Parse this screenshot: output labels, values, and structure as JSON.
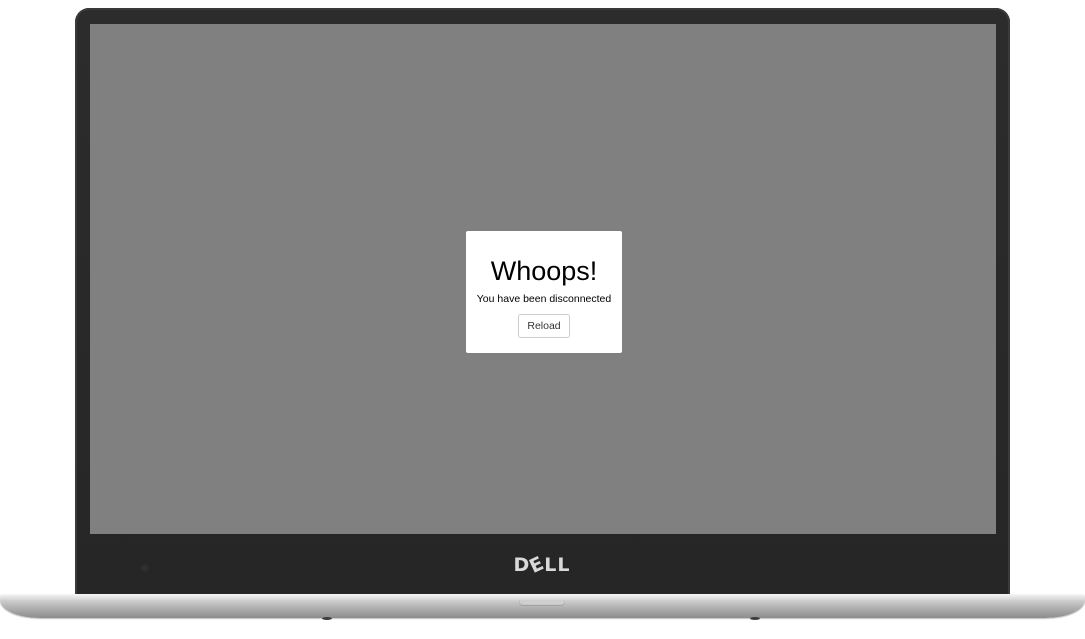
{
  "device": {
    "brand": "DELL"
  },
  "dialog": {
    "title": "Whoops!",
    "message": "You have been disconnected",
    "reload_label": "Reload"
  },
  "colors": {
    "screen_overlay": "#808080",
    "dialog_background": "#ffffff",
    "bezel": "#262626"
  }
}
